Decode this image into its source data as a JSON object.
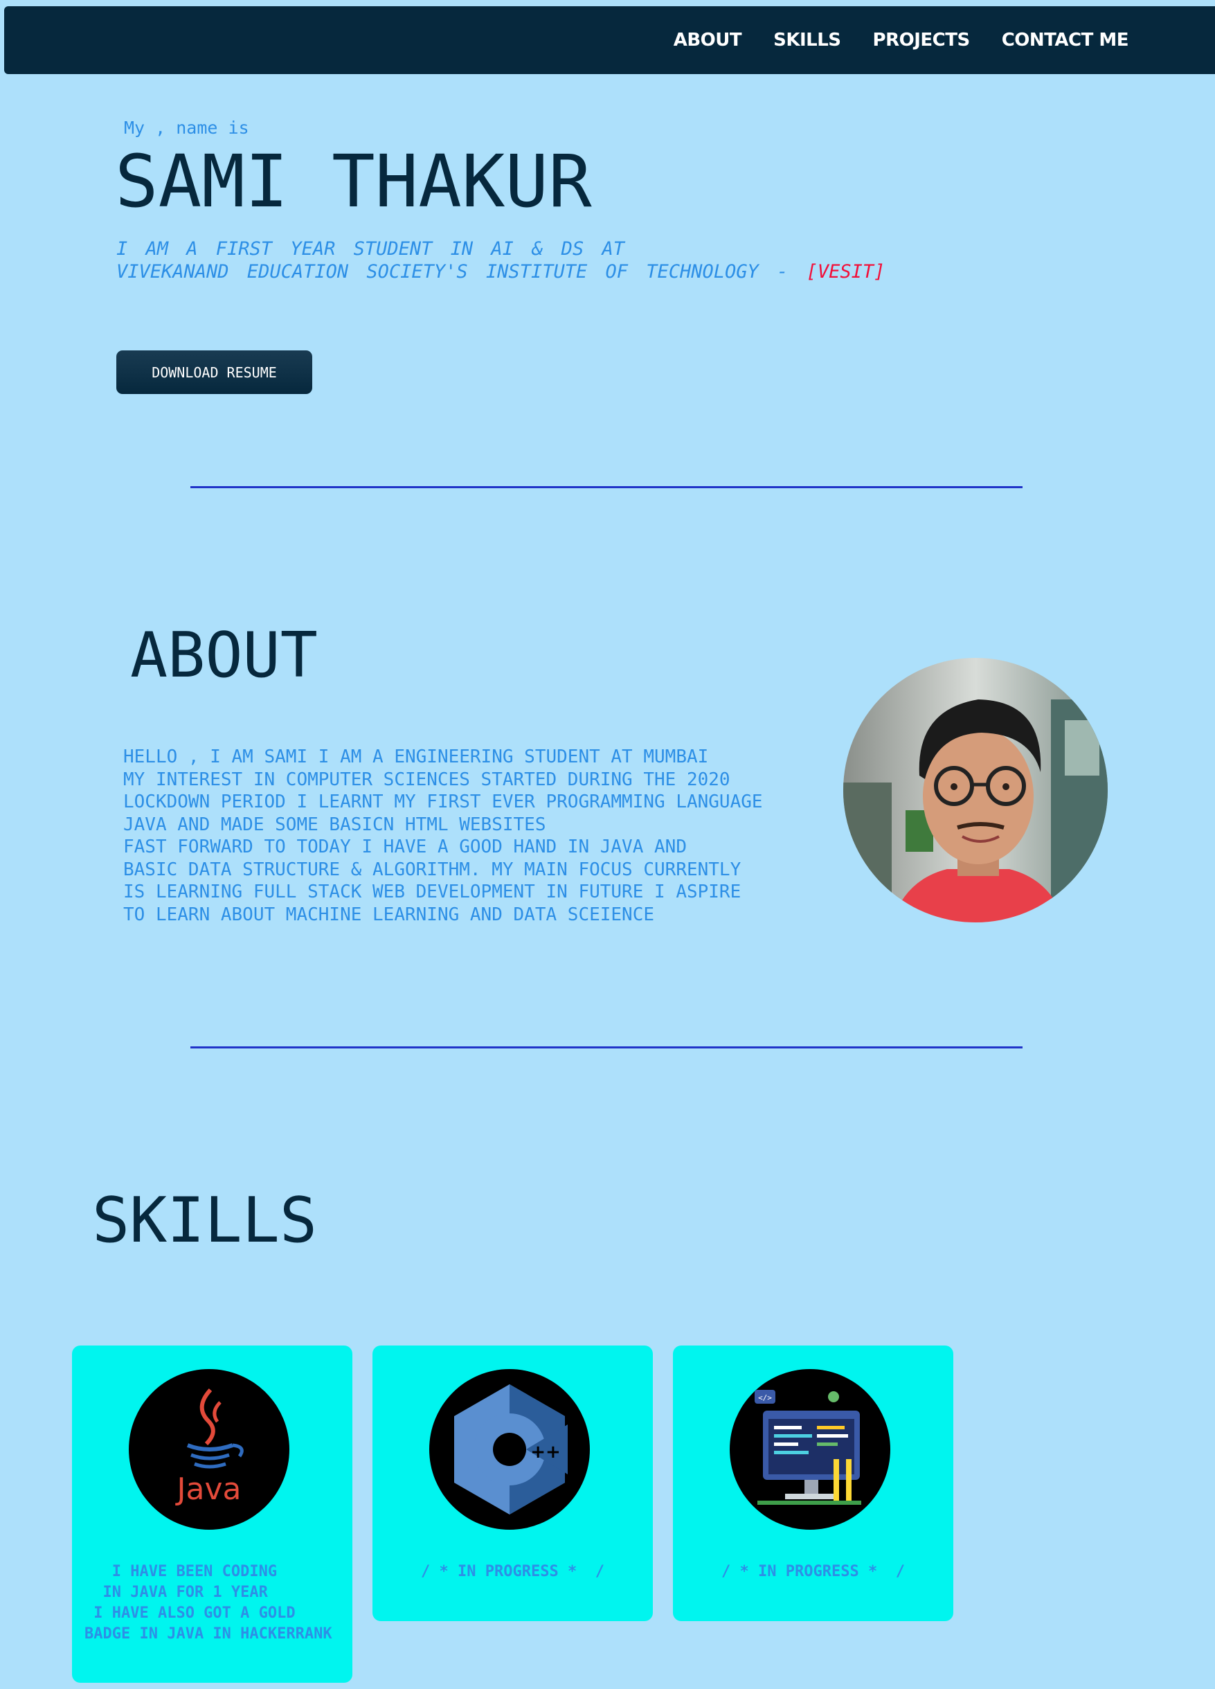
{
  "nav": {
    "items": [
      "ABOUT",
      "SKILLS",
      "PROJECTS",
      "CONTACT ME"
    ]
  },
  "hero": {
    "intro": "My , name is",
    "name": "SAMI THAKUR",
    "desc_line1": "I AM A FIRST YEAR STUDENT IN AI & DS AT",
    "desc_line2": "VIVEKANAND EDUCATION SOCIETY'S INSTITUTE OF TECHNOLOGY - ",
    "desc_accent": "[VESIT]",
    "resume_label": "DOWNLOAD RESUME"
  },
  "about": {
    "heading": "ABOUT",
    "lines": [
      "HELLO , I AM SAMI I AM A ENGINEERING STUDENT AT MUMBAI",
      "MY INTEREST IN COMPUTER SCIENCES STARTED DURING THE 2020",
      "LOCKDOWN PERIOD I LEARNT MY FIRST EVER PROGRAMMING LANGUAGE",
      "JAVA AND MADE SOME BASICN HTML WEBSITES",
      "FAST FORWARD TO TODAY I HAVE A GOOD HAND IN JAVA AND",
      "BASIC DATA STRUCTURE & ALGORITHM. MY MAIN FOCUS CURRENTLY",
      "IS LEARNING FULL STACK WEB DEVELOPMENT IN FUTURE I ASPIRE",
      "TO LEARN ABOUT MACHINE LEARNING AND DATA SCEIENCE"
    ]
  },
  "skills": {
    "heading": "SKILLS",
    "cards": [
      {
        "logo_text": "Java",
        "text": "   I HAVE BEEN CODING\n  IN JAVA FOR 1 YEAR\n I HAVE ALSO GOT A GOLD\nBADGE IN JAVA IN HACKERRANK"
      },
      {
        "logo_text": "++",
        "text": "/ * IN PROGRESS *  /"
      },
      {
        "logo_text": "</>",
        "text": "/ * IN PROGRESS *  /"
      }
    ]
  },
  "colors": {
    "background": "#ade0fb",
    "navbar": "#06283d",
    "accent_text": "#2d8fe6",
    "highlight": "#f2103a",
    "divider": "#2033c8",
    "card": "#00f5ef"
  }
}
